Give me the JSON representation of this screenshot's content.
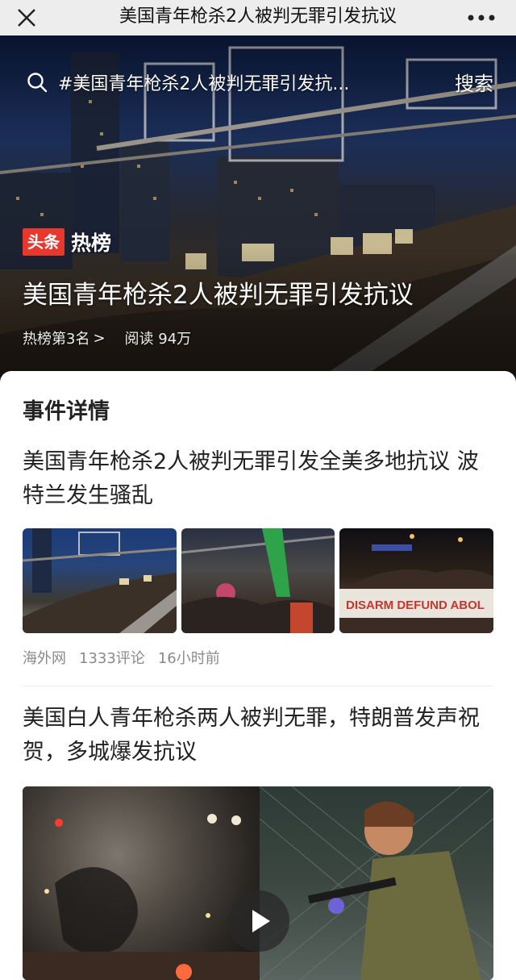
{
  "appbar": {
    "title": "美国青年枪杀2人被判无罪引发抗议",
    "close_icon": "close-icon",
    "more_icon": "more-icon"
  },
  "hero": {
    "search_query": "#美国青年枪杀2人被判无罪引发抗...",
    "search_label": "搜索",
    "brand_logo": "头条",
    "brand_board": "热榜",
    "title": "美国青年枪杀2人被判无罪引发抗议",
    "rank": "热榜第3名",
    "rank_chevron": ">",
    "reads": "阅读 94万"
  },
  "content": {
    "section_title": "事件详情",
    "articles": [
      {
        "title": "美国青年枪杀2人被判无罪引发全美多地抗议 波特兰发生骚乱",
        "source": "海外网",
        "comments": "1333评论",
        "time": "16小时前",
        "banner_text": "DISARM DEFUND ABOL"
      },
      {
        "title": "美国白人青年枪杀两人被判无罪，特朗普发声祝贺，多城爆发抗议",
        "play_icon": "play-icon"
      }
    ]
  },
  "colors": {
    "brand_red": "#e8372d",
    "appbar_bg": "#ededed",
    "meta_gray": "#8a8a8a"
  }
}
